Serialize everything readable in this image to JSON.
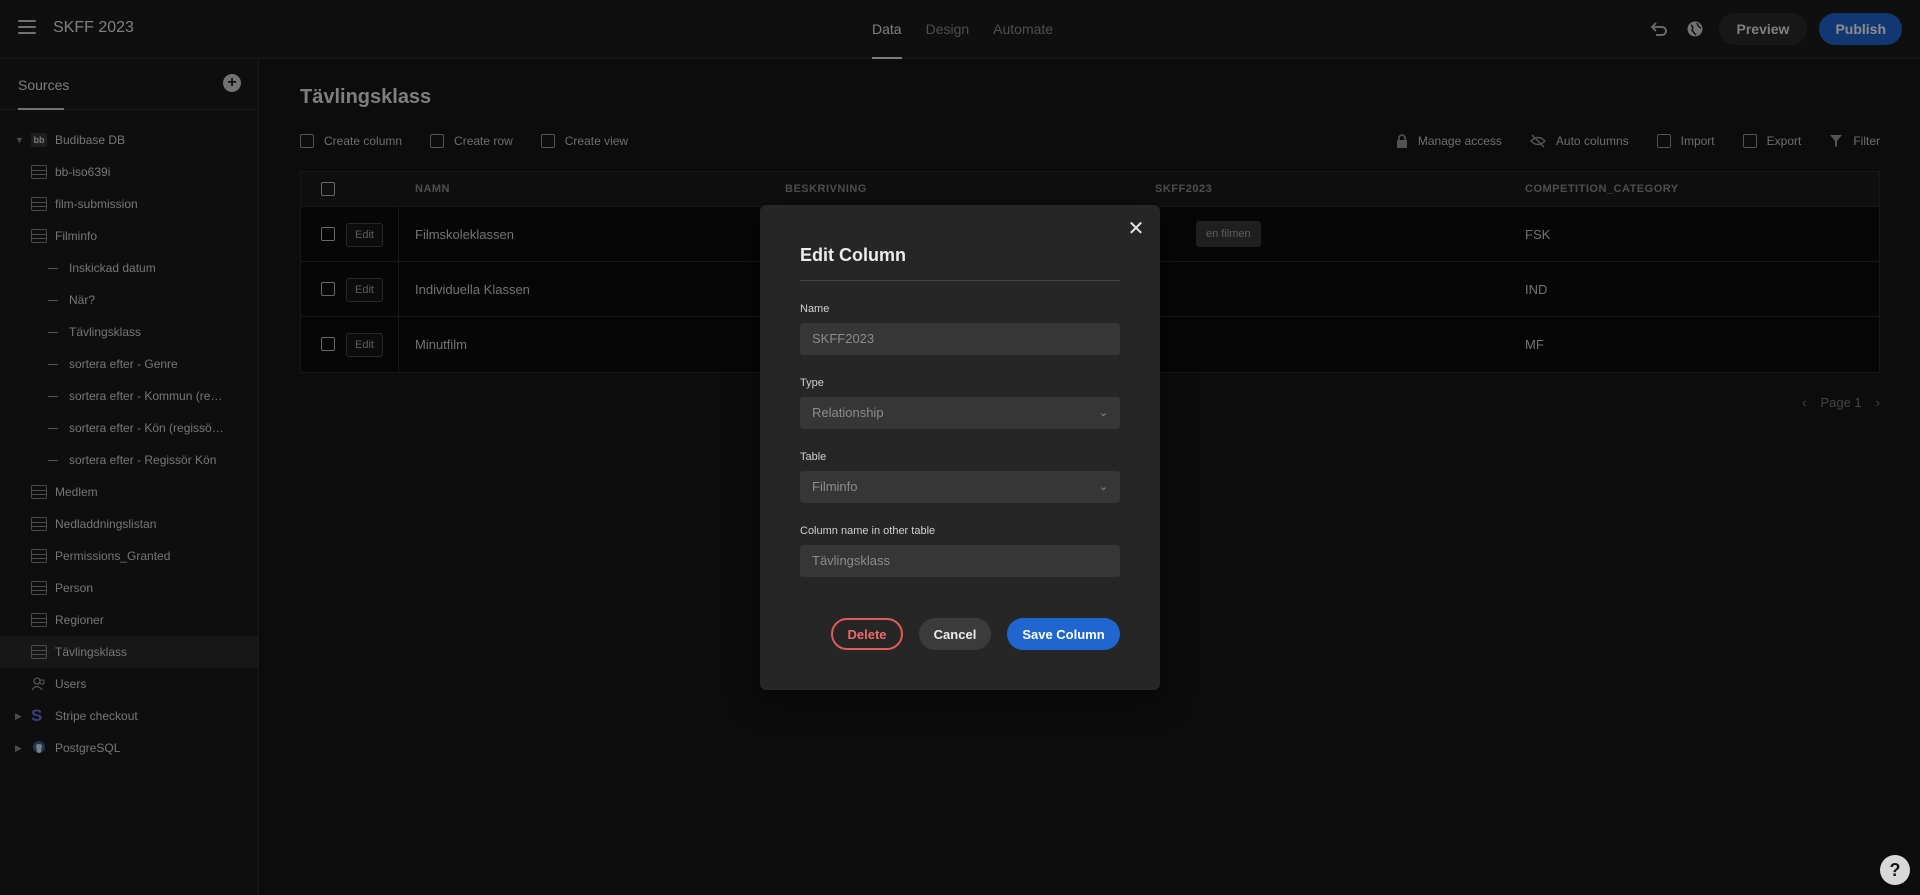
{
  "app": {
    "title": "SKFF 2023"
  },
  "top_tabs": [
    {
      "label": "Data",
      "active": true
    },
    {
      "label": "Design",
      "active": false
    },
    {
      "label": "Automate",
      "active": false
    }
  ],
  "top_actions": {
    "preview": "Preview",
    "publish": "Publish"
  },
  "sidebar": {
    "tab": "Sources",
    "items": [
      {
        "label": "Budibase DB",
        "icon": "budibase-db-icon",
        "level": 0,
        "expanded": true
      },
      {
        "label": "bb-iso639i",
        "icon": "table-icon",
        "level": 1
      },
      {
        "label": "film-submission",
        "icon": "table-icon",
        "level": 1
      },
      {
        "label": "Filminfo",
        "icon": "table-icon",
        "level": 1
      },
      {
        "label": "Inskickad datum",
        "icon": "view-icon",
        "level": 2
      },
      {
        "label": "När?",
        "icon": "view-icon",
        "level": 2
      },
      {
        "label": "Tävlingsklass",
        "icon": "view-icon",
        "level": 2
      },
      {
        "label": "sortera efter - Genre",
        "icon": "view-icon",
        "level": 2
      },
      {
        "label": "sortera efter - Kommun (re…",
        "icon": "view-icon",
        "level": 2
      },
      {
        "label": "sortera efter - Kön (regissö…",
        "icon": "view-icon",
        "level": 2
      },
      {
        "label": "sortera efter - Regissör Kön",
        "icon": "view-icon",
        "level": 2
      },
      {
        "label": "Medlem",
        "icon": "table-icon",
        "level": 1
      },
      {
        "label": "Nedladdningslistan",
        "icon": "table-icon",
        "level": 1
      },
      {
        "label": "Permissions_Granted",
        "icon": "table-icon",
        "level": 1
      },
      {
        "label": "Person",
        "icon": "table-icon",
        "level": 1
      },
      {
        "label": "Regioner",
        "icon": "table-icon",
        "level": 1
      },
      {
        "label": "Tävlingsklass",
        "icon": "table-icon",
        "level": 1,
        "selected": true
      },
      {
        "label": "Users",
        "icon": "users-icon",
        "level": 1
      },
      {
        "label": "Stripe checkout",
        "icon": "stripe-icon",
        "level": 0
      },
      {
        "label": "PostgreSQL",
        "icon": "postgres-icon",
        "level": 0
      }
    ]
  },
  "main": {
    "title": "Tävlingsklass",
    "actions_left": [
      "Create column",
      "Create row",
      "Create view"
    ],
    "actions_right": [
      "Manage access",
      "Auto columns",
      "Import",
      "Export",
      "Filter"
    ],
    "columns": [
      "NAMN",
      "BESKRIVNING",
      "SKFF2023",
      "COMPETITION_CATEGORY"
    ],
    "edit_label": "Edit",
    "rows": [
      {
        "namn": "Filmskoleklassen",
        "skff": "en filmen",
        "category": "FSK"
      },
      {
        "namn": "Individuella Klassen",
        "skff": "",
        "category": "IND"
      },
      {
        "namn": "Minutfilm",
        "skff": "",
        "category": "MF"
      }
    ],
    "pager": "Page 1"
  },
  "modal": {
    "title": "Edit Column",
    "name_label": "Name",
    "name_value": "SKFF2023",
    "type_label": "Type",
    "type_value": "Relationship",
    "table_label": "Table",
    "table_value": "Filminfo",
    "other_label": "Column name in other table",
    "other_value": "Tävlingsklass",
    "delete": "Delete",
    "cancel": "Cancel",
    "save": "Save Column"
  },
  "help": "?"
}
